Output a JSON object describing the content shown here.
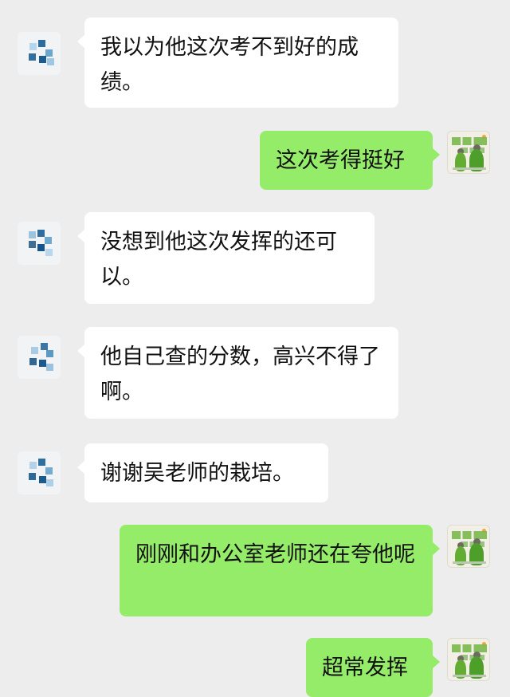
{
  "chat": {
    "messages": [
      {
        "side": "left",
        "text": "我以为他这次考不到好的成绩。",
        "avatar": "blurred-avatar-icon"
      },
      {
        "side": "right",
        "text": "这次考得挺好",
        "avatar": "poster-avatar-icon"
      },
      {
        "side": "left",
        "text": "没想到他这次发挥的还可以。",
        "avatar": "blurred-avatar-icon"
      },
      {
        "side": "left",
        "text": "他自己查的分数，高兴不得了啊。",
        "avatar": "blurred-avatar-icon"
      },
      {
        "side": "left",
        "text": "谢谢吴老师的栽培。",
        "avatar": "blurred-avatar-icon"
      },
      {
        "side": "right",
        "text": "刚刚和办公室老师还在夸他呢",
        "avatar": "poster-avatar-icon"
      },
      {
        "side": "right",
        "text": "超常发挥",
        "avatar": "poster-avatar-icon"
      }
    ]
  },
  "colors": {
    "background": "#ededed",
    "incoming_bubble": "#ffffff",
    "outgoing_bubble": "#95ec69",
    "text": "#111111"
  }
}
